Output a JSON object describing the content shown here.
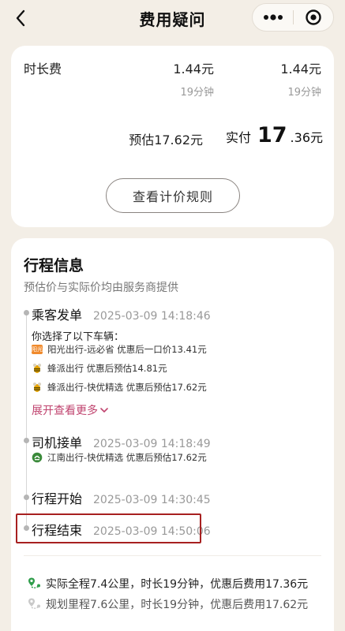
{
  "nav": {
    "title": "费用疑问"
  },
  "fee": {
    "row": {
      "name": "时长费",
      "estimate_amount": "1.44元",
      "estimate_duration": "19分钟",
      "actual_amount": "1.44元",
      "actual_duration": "19分钟"
    },
    "total_estimate": "预估17.62元",
    "total_actual_label": "实付",
    "total_actual_int": "17",
    "total_actual_dec": ".36元",
    "rule_button": "查看计价规则"
  },
  "trip": {
    "title": "行程信息",
    "note": "预估价与实际价均由服务商提供",
    "events": [
      {
        "title": "乘客发单",
        "time": "2025-03-09 14:18:46",
        "desc": "你选择了以下车辆：",
        "options": [
          {
            "logo_text": "阳光",
            "text": "阳光出行-远必省 优惠后一口价13.41元"
          },
          {
            "icon": "bee-icon",
            "text": "蜂派出行 优惠后预估14.81元"
          },
          {
            "icon": "bee-icon",
            "text": "蜂派出行-快优精选 优惠后预估17.62元"
          }
        ],
        "expand_label": "展开查看更多"
      },
      {
        "title": "司机接单",
        "time": "2025-03-09 14:18:49",
        "options": [
          {
            "icon": "jiangnan-logo-icon",
            "text": "江南出行-快优精选 优惠后预估17.62元"
          }
        ]
      },
      {
        "title": "行程开始",
        "time": "2025-03-09 14:30:45"
      },
      {
        "title": "行程结束",
        "time": "2025-03-09 14:50:06"
      }
    ],
    "summary": [
      {
        "icon": "route-pin-icon",
        "color": "#2e9d4a",
        "text": "实际全程7.4公里，时长19分钟，优惠后费用17.36元"
      },
      {
        "icon": "route-pin-icon",
        "color": "#c9c9c9",
        "text": "规划里程7.6公里，时长19分钟，优惠后费用17.62元"
      }
    ]
  },
  "colors": {
    "background": "#f3eee6",
    "expand_link": "#c0446f",
    "highlight_border": "#a72020",
    "logo_orange": "#f08a2c"
  }
}
